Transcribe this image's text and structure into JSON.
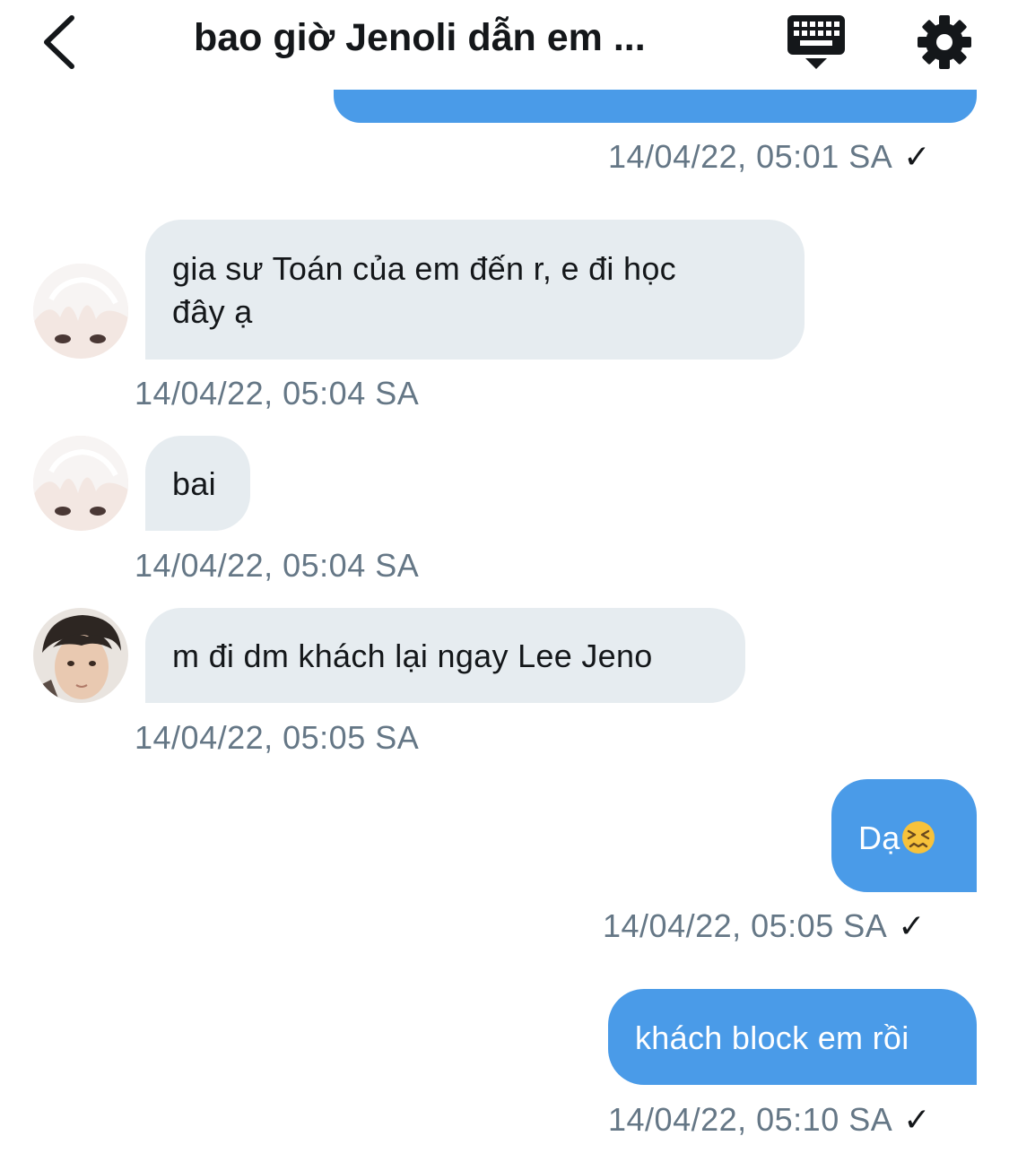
{
  "header": {
    "title": "bao giờ Jenoli dẫn em ...",
    "back_icon": "chevron-left-icon",
    "keyboard_icon": "keyboard-icon",
    "settings_icon": "gear-icon"
  },
  "colors": {
    "sent_bubble": "#4a9be8",
    "received_bubble": "#e6ecf0",
    "timestamp": "#657786"
  },
  "messages": [
    {
      "side": "sent",
      "text": "",
      "time": "14/04/22, 05:01 SA",
      "status": "✓"
    },
    {
      "side": "received",
      "text_lines": [
        "gia sư Toán của em đến r, e đi học",
        "đây ạ"
      ],
      "time": "14/04/22, 05:04 SA"
    },
    {
      "side": "received",
      "text": "bai",
      "time": "14/04/22, 05:04 SA"
    },
    {
      "side": "received",
      "text": "m đi dm khách lại ngay Lee Jeno",
      "time": "14/04/22, 05:05 SA"
    },
    {
      "side": "sent",
      "text": "Dạ",
      "emoji": "😣",
      "time": "14/04/22, 05:05 SA",
      "status": "✓"
    },
    {
      "side": "sent",
      "text": "khách block em rồi",
      "time": "14/04/22, 05:10 SA",
      "status": "✓"
    }
  ]
}
